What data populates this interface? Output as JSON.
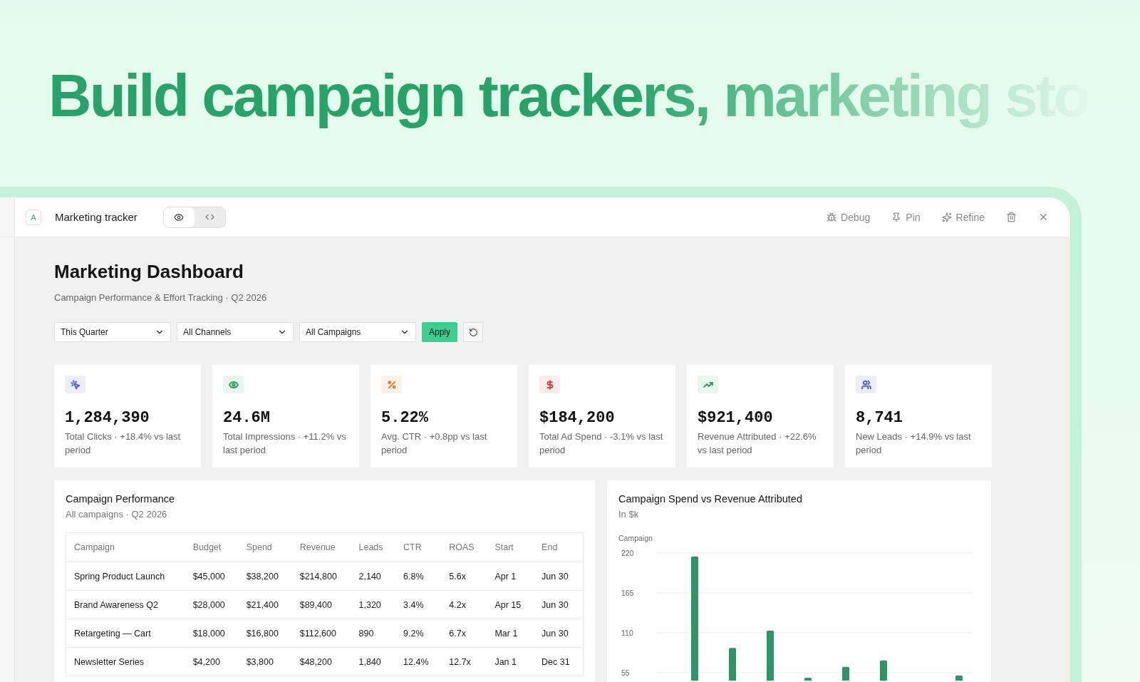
{
  "headline": "Build campaign trackers, marketing sto",
  "window": {
    "badge": "A",
    "title": "Marketing tracker",
    "views": [
      {
        "kind": "preview",
        "selected": true
      },
      {
        "kind": "code",
        "selected": false
      }
    ],
    "actions": [
      {
        "kind": "debug",
        "label": "Debug"
      },
      {
        "kind": "pin",
        "label": "Pin"
      },
      {
        "kind": "refine",
        "label": "Refine"
      },
      {
        "kind": "delete"
      },
      {
        "kind": "close"
      }
    ]
  },
  "page": {
    "title": "Marketing Dashboard",
    "subtitle": "Campaign Performance & Effort Tracking · Q2 2026"
  },
  "filters": [
    {
      "value": "This Quarter"
    },
    {
      "value": "All Channels"
    },
    {
      "value": "All Campaigns"
    }
  ],
  "apply_button": "Apply",
  "kpis": [
    {
      "kind": "clicks",
      "color": "#5b5bd6",
      "value": "1,284,390",
      "caption": "Total Clicks · +18.4% vs last period"
    },
    {
      "kind": "impressions",
      "color": "#2f9e64",
      "value": "24.6M",
      "caption": "Total Impressions · +11.2% vs last period"
    },
    {
      "kind": "ctr",
      "color": "#d9822b",
      "value": "5.22%",
      "caption": "Avg. CTR · +0.8pp vs last period"
    },
    {
      "kind": "spend",
      "color": "#d94848",
      "value": "$184,200",
      "caption": "Total Ad Spend · -3.1% vs last period"
    },
    {
      "kind": "revenue",
      "color": "#2f9e64",
      "value": "$921,400",
      "caption": "Revenue Attributed · +22.6% vs last period"
    },
    {
      "kind": "leads",
      "color": "#5b5bd6",
      "value": "8,741",
      "caption": "New Leads · +14.9% vs last period"
    }
  ],
  "table_panel": {
    "title": "Campaign Performance",
    "subtitle": "All campaigns · Q2 2026",
    "columns": [
      "Campaign",
      "Budget",
      "Spend",
      "Revenue",
      "Leads",
      "CTR",
      "ROAS",
      "Start",
      "End"
    ],
    "rows": [
      [
        "Spring Product Launch",
        "$45,000",
        "$38,200",
        "$214,800",
        "2,140",
        "6.8%",
        "5.6x",
        "Apr 1",
        "Jun 30"
      ],
      [
        "Brand Awareness Q2",
        "$28,000",
        "$21,400",
        "$89,400",
        "1,320",
        "3.4%",
        "4.2x",
        "Apr 15",
        "Jun 30"
      ],
      [
        "Retargeting — Cart",
        "$18,000",
        "$16,800",
        "$112,600",
        "890",
        "9.2%",
        "6.7x",
        "Mar 1",
        "Jun 30"
      ],
      [
        "Newsletter Series",
        "$4,200",
        "$3,800",
        "$48,200",
        "1,840",
        "12.4%",
        "12.7x",
        "Jan 1",
        "Dec 31"
      ]
    ]
  },
  "chart_panel": {
    "title": "Campaign Spend vs Revenue Attributed",
    "subtitle": "In $k",
    "chart_data": {
      "type": "bar",
      "grid": true,
      "ylabel": "Campaign",
      "ylim": [
        0,
        220
      ],
      "yticks": [
        55,
        110,
        165,
        220
      ],
      "series": [
        {
          "color": "#2f9466",
          "values": [
            215,
            89,
            113,
            48,
            63,
            72,
            null,
            51
          ]
        }
      ]
    }
  }
}
